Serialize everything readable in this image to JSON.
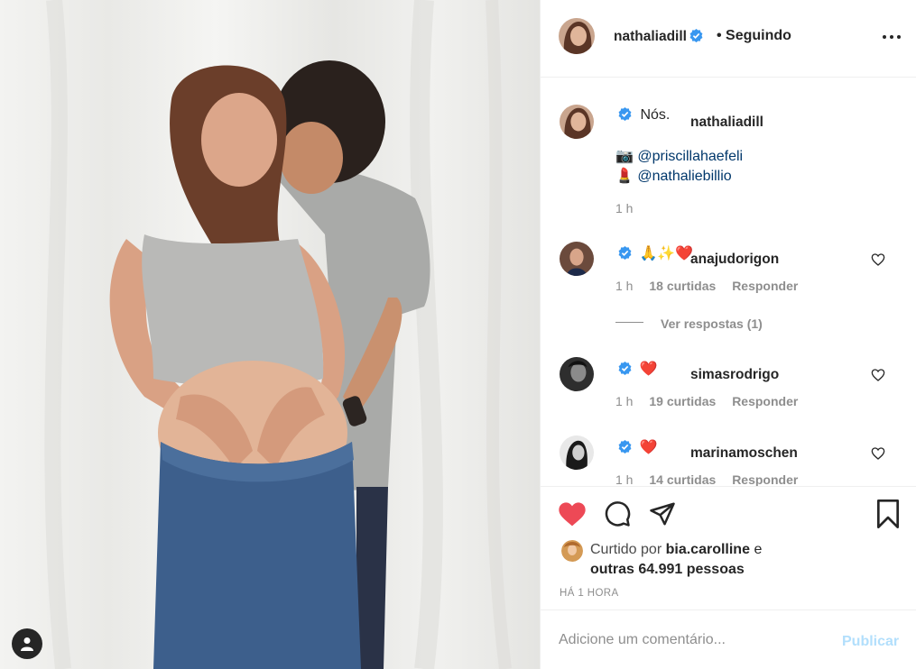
{
  "post_image": {
    "alt_icon": "person-icon"
  },
  "header": {
    "username": "nathaliadill",
    "verified": true,
    "follow_status": "• Seguindo",
    "more_icon": "more-horizontal-icon"
  },
  "caption": {
    "username": "nathaliadill",
    "text": "Nós.",
    "credit_photo_emoji": "📷",
    "credit_photo": "@priscillahaefeli",
    "credit_makeup_emoji": "💄",
    "credit_makeup": "@nathaliebillio",
    "time": "1 h"
  },
  "comments": [
    {
      "username": "anajudorigon",
      "text": "🙏✨❤️",
      "time": "1 h",
      "likes": "18 curtidas",
      "reply": "Responder"
    },
    {
      "username": "simasrodrigo",
      "text": "❤️",
      "time": "1 h",
      "likes": "19 curtidas",
      "reply": "Responder"
    },
    {
      "username": "marinamoschen",
      "text": "❤️",
      "time": "1 h",
      "likes": "14 curtidas",
      "reply": "Responder"
    }
  ],
  "view_replies": "Ver respostas (1)",
  "likes": {
    "prefix": "Curtido por",
    "user": "bia.carolline",
    "connector": "e",
    "others": "outras 64.991 pessoas"
  },
  "post_time": "HÁ 1 HORA",
  "add_comment": {
    "placeholder": "Adicione um comentário...",
    "publish": "Publicar"
  },
  "colors": {
    "like_red": "#ed4956",
    "verified_blue": "#3897f0",
    "link": "#00376b",
    "publish_disabled": "#b2dffc"
  }
}
